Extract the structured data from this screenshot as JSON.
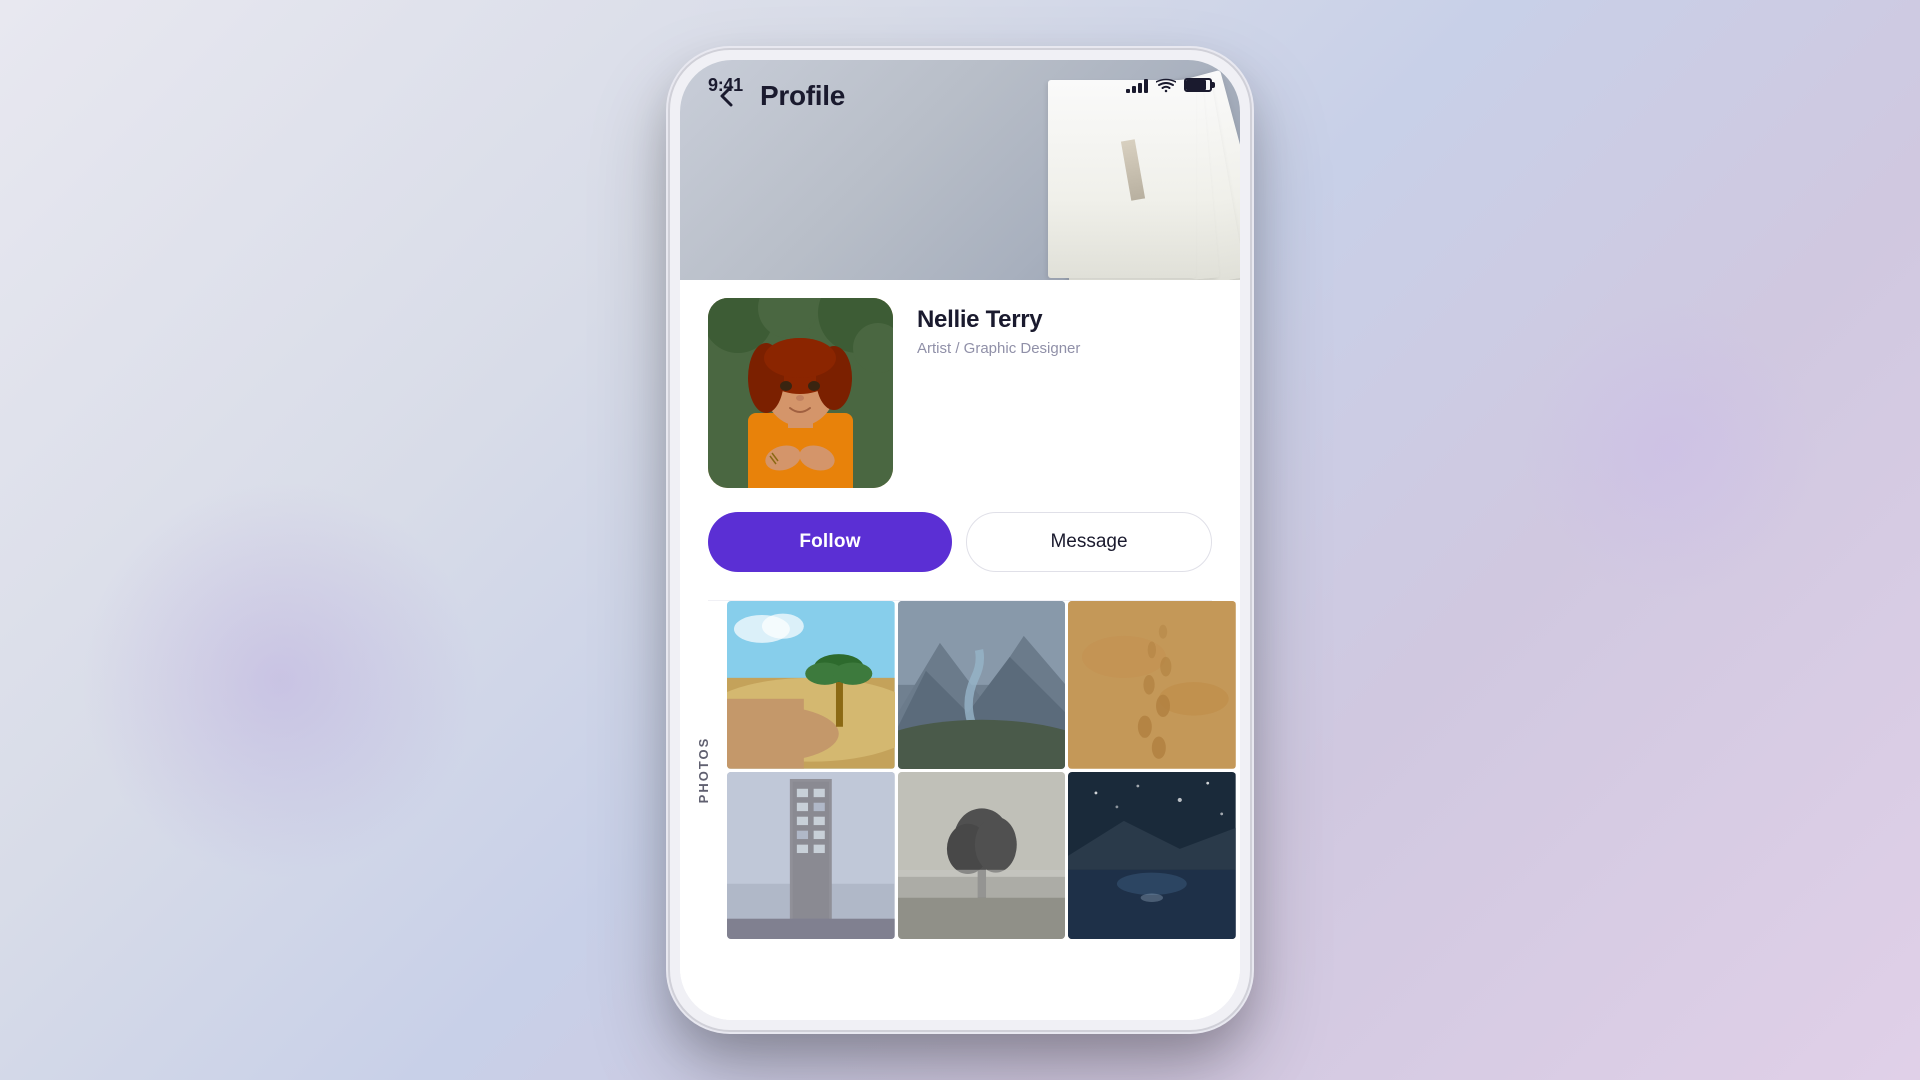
{
  "statusBar": {
    "time": "9:41",
    "signal": "signal-icon",
    "wifi": "wifi-icon",
    "battery": "battery-icon"
  },
  "header": {
    "backLabel": "‹",
    "title": "Profile"
  },
  "profile": {
    "userName": "Nellie Terry",
    "userTitle": "Artist / Graphic Designer",
    "followButton": "Follow",
    "messageButton": "Message"
  },
  "photosSection": {
    "label": "PHOTOS",
    "photos": [
      {
        "id": 1,
        "alt": "desert landscape"
      },
      {
        "id": 2,
        "alt": "mountain valley"
      },
      {
        "id": 3,
        "alt": "sand footprints"
      },
      {
        "id": 4,
        "alt": "tall building"
      },
      {
        "id": 5,
        "alt": "lone tree"
      },
      {
        "id": 6,
        "alt": "dark scene"
      }
    ]
  },
  "colors": {
    "accent": "#5B2FD4",
    "textPrimary": "#1a1a2e",
    "textSecondary": "#9090a8"
  }
}
